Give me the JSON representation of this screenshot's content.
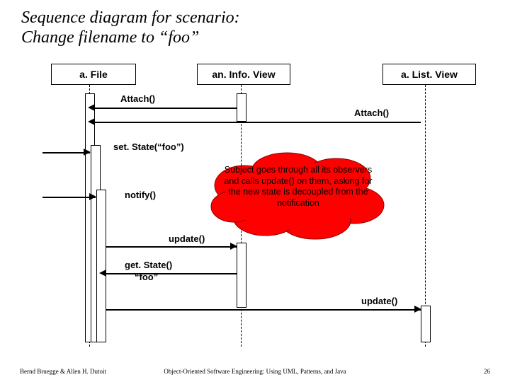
{
  "title": "Sequence diagram for scenario:\nChange filename to “foo”",
  "objects": {
    "aFile": "a. File",
    "anInfoView": "an. Info. View",
    "aListView": "a. List. View"
  },
  "messages": {
    "attach1": "Attach()",
    "attach2": "Attach()",
    "setState": "set. State(“foo”)",
    "notify": "notify()",
    "update1": "update()",
    "getState": "get. State()",
    "getStateReturn": "“foo”",
    "update2": "update()"
  },
  "callout": "Subject goes through all its observers and calls update() on them, asking for the new state is decoupled from the notification",
  "footer": {
    "left": "Bernd Bruegge & Allen H. Dutoit",
    "center": "Object-Oriented Software Engineering: Using UML, Patterns, and Java",
    "right": "26"
  }
}
